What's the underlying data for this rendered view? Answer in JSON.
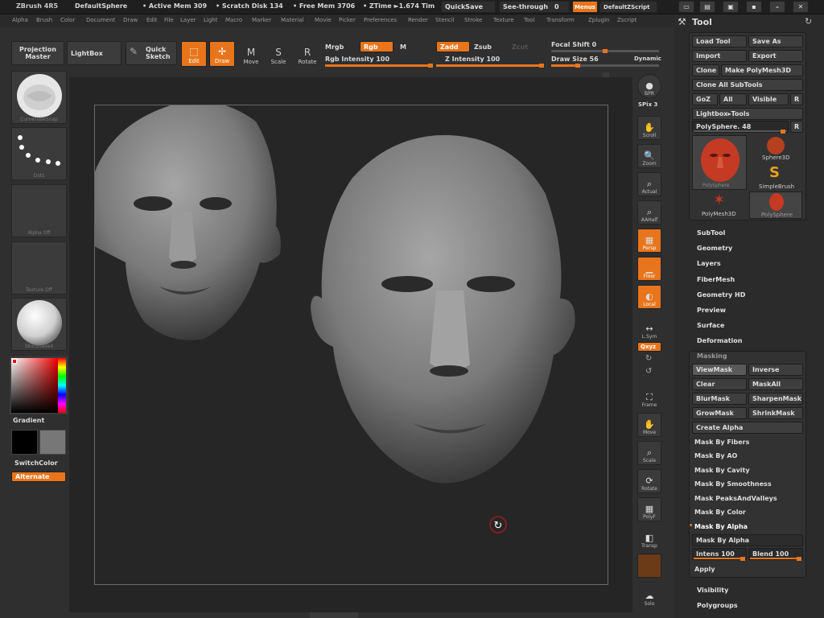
{
  "titlebar": {
    "app": "ZBrush 4R5",
    "document": "DefaultSphere",
    "active_mem": "• Active Mem 309",
    "scratch": "• Scratch Disk 134",
    "free_mem": "• Free Mem 3706",
    "ztime": "• ZTime ►1.674 Tim",
    "quicksave": "QuickSave",
    "seethrough": "See-through",
    "seethrough_val": "0",
    "menus": "Menus",
    "zscript": "DefaultZScript"
  },
  "menubar": [
    "Alpha",
    "Brush",
    "Color",
    "Document",
    "Draw",
    "Edit",
    "File",
    "Layer",
    "Light",
    "Macro",
    "Marker",
    "Material",
    "Movie",
    "Picker",
    "Preferences",
    "Render",
    "Stencil",
    "Stroke",
    "Texture",
    "Tool",
    "Transform",
    "Zplugin",
    "Zscript"
  ],
  "shelf": {
    "projection_master": "Projection Master",
    "lightbox": "LightBox",
    "quick_sketch": "Quick Sketch",
    "edit": "Edit",
    "draw": "Draw",
    "move": "Move",
    "scale": "Scale",
    "rotate": "Rotate",
    "mrgb": "Mrgb",
    "rgb": "Rgb",
    "m": "M",
    "rgb_intensity": "Rgb  Intensity 100",
    "zadd": "Zadd",
    "zsub": "Zsub",
    "zcut": "Zcut",
    "z_intensity": "Z  Intensity 100",
    "focal_shift": "Focal Shift 0",
    "draw_size": "Draw Size 56",
    "dynamic": "Dynamic",
    "rgb_intensity_value": 100,
    "z_intensity_value": 100,
    "draw_size_value": 56
  },
  "lefttray": {
    "brush_cap": "CurveTubeSnap",
    "stroke_cap": "Dots",
    "alpha_cap": "Alpha Off",
    "texture_cap": "Texture Off",
    "material_cap": "SkinShade4",
    "gradient": "Gradient",
    "switchcolor": "SwitchColor",
    "alternate": "Alternate"
  },
  "righttray": {
    "bpr": "BPR",
    "spix": "SPix 3",
    "scroll": "Scroll",
    "zoom": "Zoom",
    "actual": "Actual",
    "aahalf": "AAHalf",
    "persp": "Persp",
    "floor": "Floor",
    "local": "Local",
    "lsym": "L.Sym",
    "xyz": "Qxyz",
    "frame": "Frame",
    "move": "Move",
    "scale": "Scale",
    "rotate": "Rotate",
    "polyf": "PolyF",
    "transp": "Transp",
    "solo": "Solo"
  },
  "toolpanel": {
    "title": "Tool",
    "load_tool": "Load Tool",
    "save_as": "Save As",
    "import": "Import",
    "export": "Export",
    "clone": "Clone",
    "make_polymesh": "Make PolyMesh3D",
    "clone_all": "Clone All SubTools",
    "goz": "GoZ",
    "all": "All",
    "visible": "Visible",
    "r": "R",
    "lightbox_tools": "Lightbox▸Tools",
    "polysphere": "PolySphere. 48",
    "polysphere_value": 48,
    "tools": [
      "PolySphere",
      "Sphere3D",
      "SimpleBrush",
      "PolyMesh3D",
      "PolySphere"
    ],
    "sections": [
      "SubTool",
      "Geometry",
      "Layers",
      "FiberMesh",
      "Geometry HD",
      "Preview",
      "Surface",
      "Deformation"
    ],
    "masking": "Masking",
    "viewmask": "ViewMask",
    "inverse": "Inverse",
    "clear": "Clear",
    "maskall": "MaskAll",
    "blurmask": "BlurMask",
    "sharpenmask": "SharpenMask",
    "growmask": "GrowMask",
    "shrinkmask": "ShrinkMask",
    "create_alpha": "Create Alpha",
    "mask_items": [
      "Mask By Fibers",
      "Mask By AO",
      "Mask By Cavity",
      "Mask By Smoothness",
      "Mask PeaksAndValleys",
      "Mask By Color",
      "Mask By Alpha",
      "Mask By Alpha"
    ],
    "intens": "Intens 100",
    "blend": "Blend 100",
    "intens_value": 100,
    "blend_value": 100,
    "apply": "Apply",
    "visibility": "Visibility",
    "polygroups": "Polygroups"
  }
}
